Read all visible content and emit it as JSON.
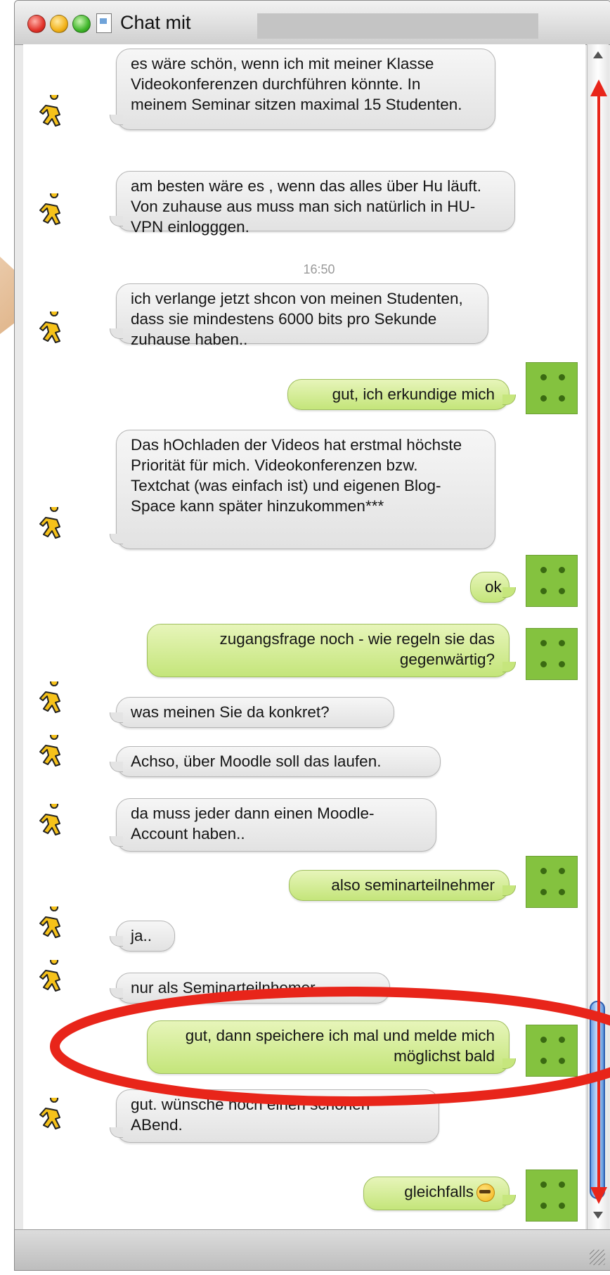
{
  "window": {
    "title": "Chat mit"
  },
  "chat": {
    "timestamp": "16:50",
    "messages": [
      {
        "from": "buddy",
        "text": "es wäre schön, wenn ich mit meiner Klasse Videokonferenzen durchführen könnte. In meinem Seminar sitzen maximal 15 Studenten."
      },
      {
        "from": "buddy",
        "text": "am besten wäre es , wenn das alles über Hu läuft. Von zuhause aus muss man sich natürlich in HU-VPN einlogggen."
      },
      {
        "from": "buddy",
        "text": "ich verlange jetzt shcon von meinen Studenten, dass sie mindestens 6000 bits pro Sekunde zuhause haben.."
      },
      {
        "from": "me",
        "text": "gut, ich erkundige mich"
      },
      {
        "from": "buddy",
        "text": "Das hOchladen der Videos hat erstmal höchste Priorität für mich. Videokonferenzen bzw. Textchat (was einfach ist) und eigenen Blog-Space kann später hinzukommen***"
      },
      {
        "from": "me",
        "text": "ok"
      },
      {
        "from": "me",
        "text": "zugangsfrage noch - wie regeln sie das gegenwärtig?"
      },
      {
        "from": "buddy",
        "text": "was meinen Sie da konkret?"
      },
      {
        "from": "buddy",
        "text": "Achso, über Moodle soll das laufen."
      },
      {
        "from": "buddy",
        "text": "da muss jeder dann einen Moodle-Account haben.."
      },
      {
        "from": "me",
        "text": "also seminarteilnehmer"
      },
      {
        "from": "buddy",
        "text": "ja.."
      },
      {
        "from": "buddy",
        "text": "nur als Seminarteilnhemer"
      },
      {
        "from": "me",
        "text": "gut, dann speichere ich mal und melde mich möglichst bald"
      },
      {
        "from": "buddy",
        "text": "gut. wünsche noch einen schönen ABend."
      },
      {
        "from": "me",
        "text": "gleichfalls"
      }
    ]
  },
  "colors": {
    "annotation": "#e8251a",
    "outgoing": "#c4e57a",
    "incoming": "#e6e6e6"
  },
  "icons": {
    "buddy": "aim-running-man-icon",
    "self": "green-lego-brick-avatar-icon",
    "emoticon": "cool-sunglasses-smiley-icon"
  }
}
